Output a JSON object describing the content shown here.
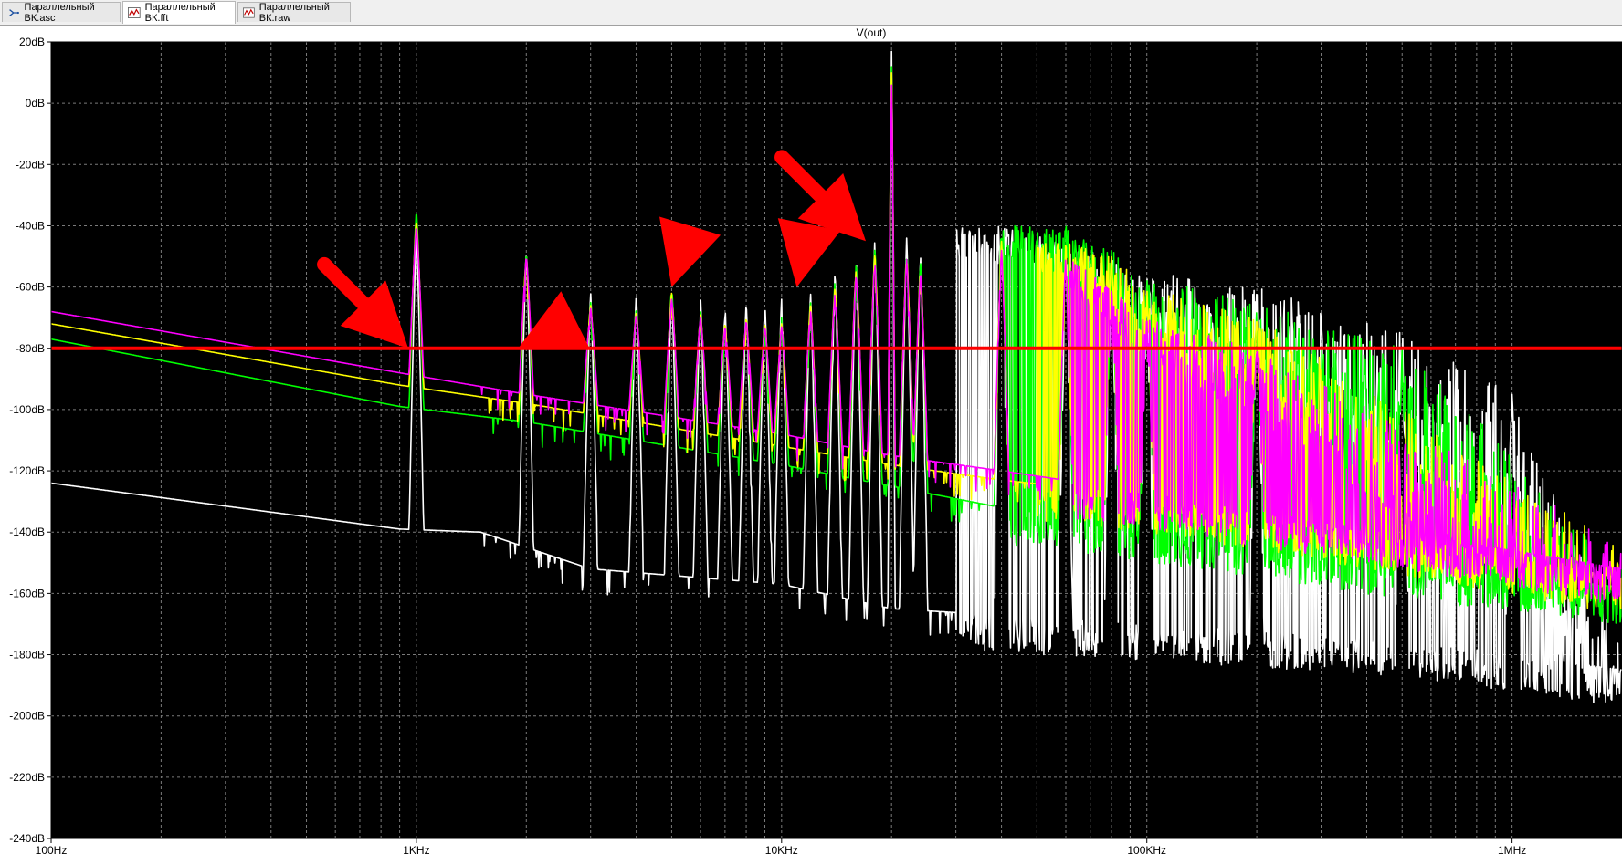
{
  "tabs": [
    {
      "label": "Параллельный ВК.asc",
      "icon": "schematic-icon"
    },
    {
      "label": "Параллельный ВК.fft",
      "icon": "waveform-icon"
    },
    {
      "label": "Параллельный ВК.raw",
      "icon": "waveform-icon"
    }
  ],
  "chart_data": {
    "type": "line",
    "title": "V(out)",
    "xlabel": "",
    "ylabel": "",
    "x_scale": "log",
    "xlim": [
      100,
      2000000
    ],
    "ylim": [
      -240,
      20
    ],
    "x_ticks": [
      {
        "value": 100,
        "label": "100Hz"
      },
      {
        "value": 1000,
        "label": "1KHz"
      },
      {
        "value": 10000,
        "label": "10KHz"
      },
      {
        "value": 100000,
        "label": "100KHz"
      },
      {
        "value": 1000000,
        "label": "1MHz"
      }
    ],
    "y_ticks": [
      20,
      0,
      -20,
      -40,
      -60,
      -80,
      -100,
      -120,
      -140,
      -160,
      -180,
      -200,
      -220,
      -240
    ],
    "y_tick_suffix": "dB",
    "grid": true,
    "background": "#000000",
    "fundamental_hz": 1000,
    "carrier_hz": 20000,
    "series": [
      {
        "color": "#ffffff",
        "baseline": [
          [
            100,
            -124
          ],
          [
            900,
            -139
          ],
          [
            1500,
            -140
          ],
          [
            3000,
            -152
          ],
          [
            10000,
            -157
          ],
          [
            20000,
            -165
          ],
          [
            100000,
            -170
          ],
          [
            500000,
            -175
          ],
          [
            2000000,
            -185
          ]
        ],
        "harmonics": [
          [
            1000,
            -42
          ],
          [
            2000,
            -48
          ],
          [
            3000,
            -62
          ],
          [
            4000,
            -62
          ],
          [
            5000,
            -61
          ],
          [
            6000,
            -64
          ],
          [
            7000,
            -66
          ],
          [
            8000,
            -65
          ],
          [
            9000,
            -65
          ],
          [
            10000,
            -64
          ],
          [
            12000,
            -62
          ],
          [
            14000,
            -55
          ],
          [
            16000,
            -50
          ],
          [
            18000,
            -44
          ],
          [
            20000,
            17
          ],
          [
            22000,
            -44
          ],
          [
            24000,
            -50
          ],
          [
            40000,
            -40
          ],
          [
            60000,
            -45
          ],
          [
            80000,
            -50
          ],
          [
            100000,
            -55
          ],
          [
            200000,
            -60
          ],
          [
            500000,
            -75
          ],
          [
            1000000,
            -95
          ]
        ],
        "noise_from_hz": 30000
      },
      {
        "color": "#00ff00",
        "baseline": [
          [
            100,
            -77
          ],
          [
            900,
            -99
          ],
          [
            2000,
            -104
          ],
          [
            10000,
            -118
          ],
          [
            20000,
            -125
          ],
          [
            40000,
            -132
          ],
          [
            100000,
            -138
          ],
          [
            500000,
            -150
          ],
          [
            2000000,
            -158
          ]
        ],
        "harmonics": [
          [
            1000,
            -35
          ],
          [
            2000,
            -49
          ],
          [
            3000,
            -65
          ],
          [
            4000,
            -67
          ],
          [
            5000,
            -60
          ],
          [
            6000,
            -68
          ],
          [
            7000,
            -72
          ],
          [
            8000,
            -70
          ],
          [
            9000,
            -72
          ],
          [
            10000,
            -70
          ],
          [
            12000,
            -65
          ],
          [
            14000,
            -58
          ],
          [
            16000,
            -52
          ],
          [
            18000,
            -47
          ],
          [
            20000,
            12
          ],
          [
            22000,
            -47
          ],
          [
            24000,
            -52
          ],
          [
            40000,
            -40
          ],
          [
            60000,
            -40
          ],
          [
            80000,
            -48
          ],
          [
            100000,
            -56
          ],
          [
            200000,
            -65
          ],
          [
            500000,
            -80
          ]
        ],
        "noise_from_hz": 40000
      },
      {
        "color": "#ffff00",
        "baseline": [
          [
            100,
            -72
          ],
          [
            900,
            -92
          ],
          [
            2000,
            -98
          ],
          [
            10000,
            -112
          ],
          [
            20000,
            -118
          ],
          [
            40000,
            -123
          ],
          [
            100000,
            -128
          ],
          [
            500000,
            -142
          ],
          [
            2000000,
            -155
          ]
        ],
        "harmonics": [
          [
            1000,
            -38
          ],
          [
            2000,
            -50
          ],
          [
            3000,
            -66
          ],
          [
            4000,
            -68
          ],
          [
            5000,
            -62
          ],
          [
            6000,
            -69
          ],
          [
            7000,
            -72
          ],
          [
            8000,
            -70
          ],
          [
            9000,
            -72
          ],
          [
            10000,
            -72
          ],
          [
            12000,
            -66
          ],
          [
            14000,
            -60
          ],
          [
            16000,
            -54
          ],
          [
            18000,
            -49
          ],
          [
            20000,
            10
          ],
          [
            22000,
            -49
          ],
          [
            24000,
            -54
          ],
          [
            40000,
            -45
          ],
          [
            60000,
            -45
          ],
          [
            80000,
            -50
          ],
          [
            100000,
            -60
          ],
          [
            200000,
            -70
          ]
        ],
        "noise_from_hz": 50000
      },
      {
        "color": "#ff00ff",
        "baseline": [
          [
            100,
            -68
          ],
          [
            900,
            -88
          ],
          [
            2000,
            -95
          ],
          [
            10000,
            -108
          ],
          [
            20000,
            -115
          ],
          [
            40000,
            -120
          ],
          [
            100000,
            -127
          ],
          [
            500000,
            -140
          ],
          [
            2000000,
            -152
          ]
        ],
        "harmonics": [
          [
            1000,
            -40
          ],
          [
            2000,
            -50
          ],
          [
            3000,
            -67
          ],
          [
            4000,
            -69
          ],
          [
            5000,
            -64
          ],
          [
            6000,
            -70
          ],
          [
            7000,
            -73
          ],
          [
            8000,
            -71
          ],
          [
            9000,
            -73
          ],
          [
            10000,
            -73
          ],
          [
            12000,
            -68
          ],
          [
            14000,
            -62
          ],
          [
            16000,
            -56
          ],
          [
            18000,
            -51
          ],
          [
            20000,
            6
          ],
          [
            22000,
            -51
          ],
          [
            24000,
            -56
          ],
          [
            40000,
            -48
          ],
          [
            60000,
            -50
          ],
          [
            80000,
            -60
          ],
          [
            100000,
            -70
          ],
          [
            200000,
            -80
          ]
        ],
        "noise_from_hz": 60000
      }
    ],
    "annotations": [
      {
        "type": "hline",
        "y": -80,
        "color": "#ff0000"
      },
      {
        "type": "arrow",
        "color": "#ff0000",
        "tip": [
          950,
          -80
        ],
        "direction": "down-right"
      },
      {
        "type": "arrow",
        "color": "#ff0000",
        "tip": [
          1900,
          -80
        ],
        "direction": "left"
      },
      {
        "type": "arrow",
        "color": "#ff0000",
        "tip": [
          5000,
          -60
        ],
        "direction": "down-left"
      },
      {
        "type": "arrow",
        "color": "#ff0000",
        "tip": [
          11000,
          -60
        ],
        "direction": "down"
      },
      {
        "type": "arrow",
        "color": "#ff0000",
        "tip": [
          17000,
          -45
        ],
        "direction": "down-right"
      }
    ]
  }
}
